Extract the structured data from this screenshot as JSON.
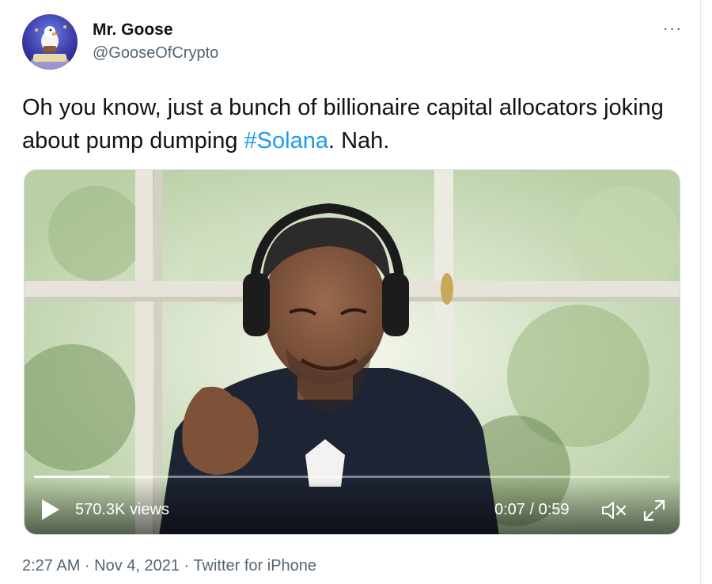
{
  "author": {
    "name": "Mr. Goose",
    "handle": "@GooseOfCrypto",
    "avatar_icon": "avatar-goose-icon"
  },
  "more_icon": "more-options-icon",
  "tweet": {
    "text_before": "Oh you know, just a bunch of billionaire capital allocators joking about pump dumping ",
    "hashtag": "#Solana",
    "text_after": ". Nah."
  },
  "video": {
    "views": "570.3K views",
    "time": "0:07 / 0:59",
    "progress_fraction": 0.118,
    "play_icon": "play-icon",
    "mute_icon": "muted-speaker-icon",
    "fullscreen_icon": "fullscreen-icon"
  },
  "meta": {
    "timestamp": "2:27 AM · Nov 4, 2021 · Twitter for iPhone"
  },
  "colors": {
    "link": "#1d9bf0",
    "secondary_text": "#536471",
    "primary_text": "#0f1419"
  }
}
